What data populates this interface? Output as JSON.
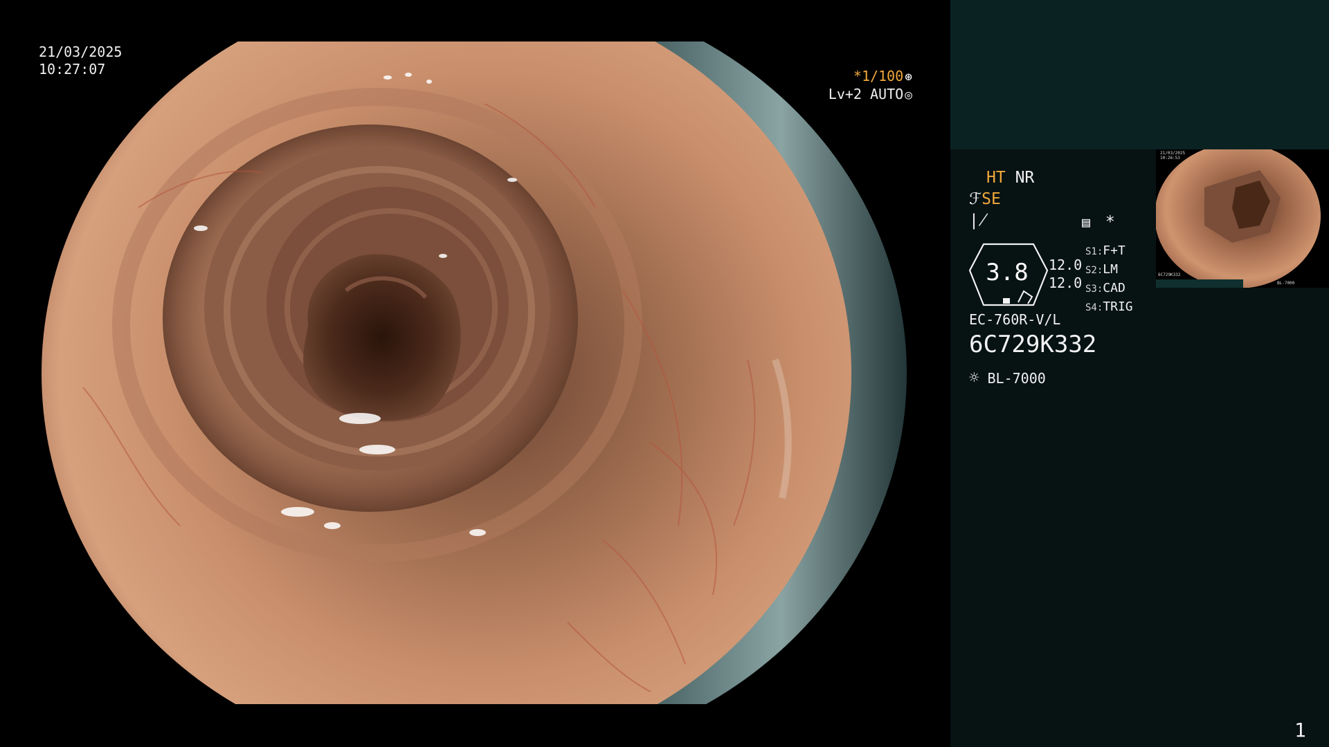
{
  "osd": {
    "date": "21/03/2025",
    "time": "10:27:07",
    "shutter_prefix": "*",
    "shutter": "1/100",
    "shutter_icon": "aperture-icon",
    "level": "Lv+2 AUTO",
    "level_icon": "iris-icon"
  },
  "panel": {
    "ht_label": "HT",
    "nr_label": "NR",
    "se_label": "SE",
    "se_icon": "structure-enhancement-icon",
    "misc_icon": "edge-icon",
    "settings_icon": "menu-list-icon",
    "star_label": "*",
    "gauge_value": "3.8",
    "gauge_num_1": "12.0",
    "gauge_num_2": "12.0",
    "switches": [
      {
        "key": "S1:",
        "value": "F+T"
      },
      {
        "key": "S2:",
        "value": "LM"
      },
      {
        "key": "S3:",
        "value": "CAD"
      },
      {
        "key": "S4:",
        "value": "TRIG"
      }
    ],
    "scope_model": "EC-760R-V/L",
    "scope_serial": "6C729K332",
    "light_icon": "light-source-icon",
    "light_source": "BL-7000",
    "page_number": "1"
  },
  "thumbnail": {
    "date": "21/03/2025",
    "time": "10:26:53",
    "serial": "6C729K332",
    "footer": "BL-7000"
  },
  "colors": {
    "amber_accent": "#f2a93b",
    "panel_bg": "#071213",
    "panel_top_bg": "#0b2223",
    "mucosa": "#c98f6c"
  }
}
